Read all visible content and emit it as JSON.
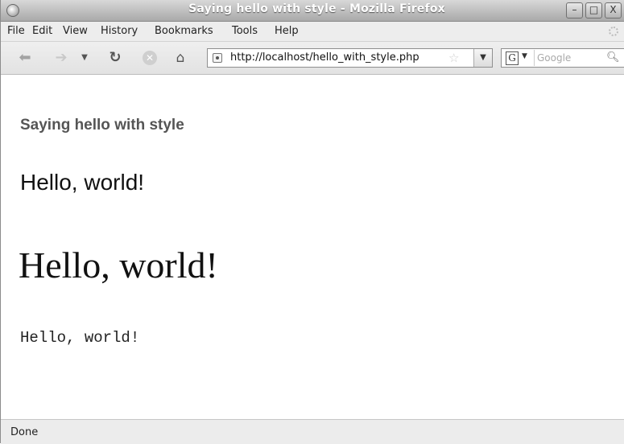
{
  "window": {
    "title": "Saying hello with style - Mozilla Firefox",
    "buttons": {
      "minimize": "–",
      "maximize": "□",
      "close": "X"
    }
  },
  "menu": [
    "File",
    "Edit",
    "View",
    "History",
    "Bookmarks",
    "Tools",
    "Help"
  ],
  "toolbar": {
    "url": "http://localhost/hello_with_style.php",
    "search_placeholder": "Google",
    "search_engine_letter": "G"
  },
  "icons": {
    "back": "back-arrow-icon",
    "forward": "forward-arrow-icon",
    "history_dropdown": "chevron-down-icon",
    "reload": "reload-icon",
    "stop": "stop-icon",
    "home": "home-icon",
    "site": "site-identity-icon",
    "bookmark": "star-icon",
    "search": "magnifier-icon"
  },
  "content": {
    "heading": "Saying hello with style",
    "hello_sans": "Hello, world!",
    "hello_serif": "Hello, world!",
    "hello_mono": "Hello, world!"
  },
  "status": "Done",
  "colors": {
    "heading": "#555555",
    "titlebar": "#a9a9a9"
  }
}
